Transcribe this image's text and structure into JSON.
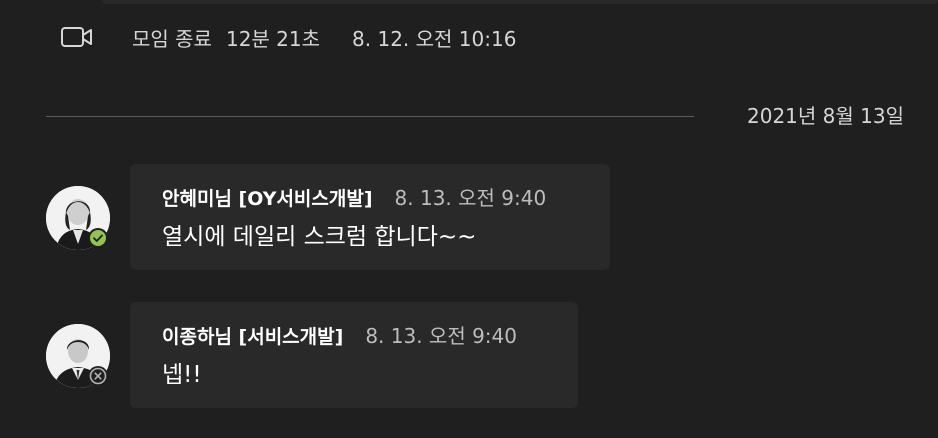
{
  "meeting_end": {
    "icon": "video-camera-icon",
    "text": "모임 종료",
    "duration": "12분 21초",
    "time": "8. 12. 오전 10:16"
  },
  "date_divider": {
    "label": "2021년 8월 13일"
  },
  "messages": [
    {
      "author": "안혜미님 [OY서비스개발]",
      "timestamp": "8. 13. 오전 9:40",
      "text": "열시에 데일리 스크럼 합니다~~",
      "presence": "available"
    },
    {
      "author": "이종하님 [서비스개발]",
      "timestamp": "8. 13. 오전 9:40",
      "text": "넵!!",
      "presence": "offline"
    }
  ],
  "colors": {
    "background": "#1f1f1f",
    "bubble": "#292929",
    "available": "#92c353",
    "offline": "#b3b3b3",
    "muted_text": "#d6d6d6"
  }
}
